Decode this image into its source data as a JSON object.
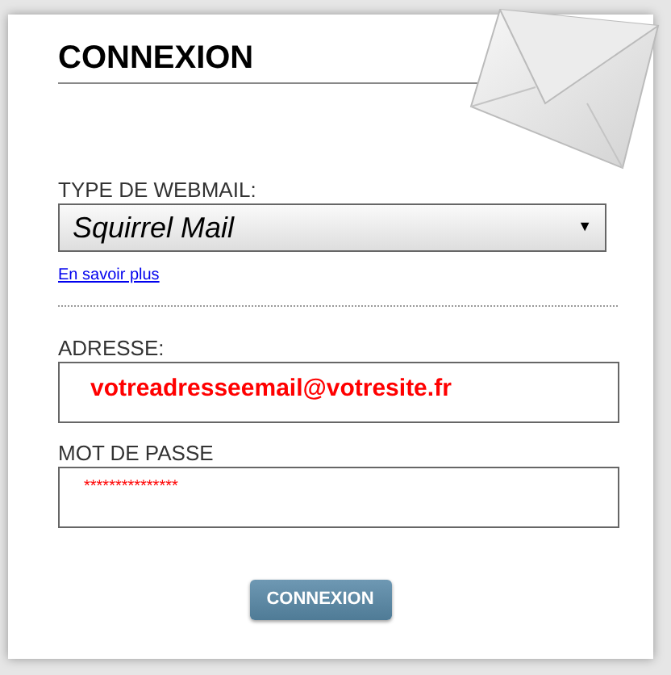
{
  "title": "CONNEXION",
  "webmail": {
    "label": "TYPE DE WEBMAIL:",
    "value": "Squirrel Mail",
    "caret": "▼"
  },
  "link": "En savoir plus",
  "address": {
    "label": "ADRESSE:",
    "value": "votreadresseemail@votresite.fr"
  },
  "password": {
    "label": "MOT DE PASSE",
    "value": "***************"
  },
  "button": "CONNEXION"
}
